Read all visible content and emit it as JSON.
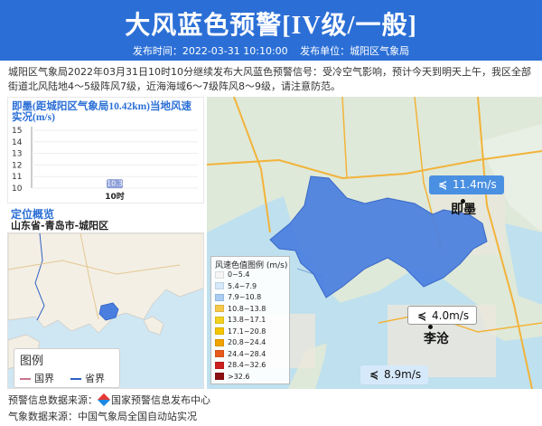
{
  "header": {
    "title": "大风蓝色预警[IV级/一般]",
    "publish_time_label": "发布时间：2022-03-31 10:10:00",
    "publish_unit_label": "发布单位：城阳区气象局"
  },
  "description": "城阳区气象局2022年03月31日10时10分继续发布大风蓝色预警信号：受冷空气影响，预计今天到明天上午，我区全部街道北风陆地4～5级阵风7级，近海海域6～7级阵风8～9级，请注意防范。",
  "chart": {
    "title": "即墨(距城阳区气象局10.42km)当地风速实况(m/s)"
  },
  "chart_data": {
    "type": "bar",
    "categories": [
      "10时"
    ],
    "values": [
      10.3
    ],
    "title": "即墨(距城阳区气象局10.42km)当地风速实况(m/s)",
    "ylabel": "m/s",
    "ylim": [
      10,
      15
    ],
    "yticks": [
      "15",
      "14",
      "13",
      "12",
      "11",
      "10"
    ],
    "data_labels": [
      "10.3"
    ],
    "colors": {
      "bar": "#aeb9dd",
      "label": "#8e9fd8",
      "grid": "#eeeeee"
    }
  },
  "location": {
    "title": "定位概览",
    "place": "山东省-青岛市-城阳区"
  },
  "minimap_legend": {
    "title": "图例",
    "national_border": "国界",
    "province_border": "省界",
    "national_border_color": "#c9748a",
    "province_border_color": "#2d5fc4"
  },
  "wind_scale": {
    "title": "风速色值图例 (m/s)",
    "items": [
      {
        "label": "0~5.4",
        "color": "#f5f5f5"
      },
      {
        "label": "5.4~7.9",
        "color": "#d6e9fb"
      },
      {
        "label": "7.9~10.8",
        "color": "#a7cdf3"
      },
      {
        "label": "10.8~13.8",
        "color": "#f7c94a"
      },
      {
        "label": "13.8~17.1",
        "color": "#f2d21f"
      },
      {
        "label": "17.1~20.8",
        "color": "#f5c400"
      },
      {
        "label": "20.8~24.4",
        "color": "#f0a300"
      },
      {
        "label": "24.4~28.4",
        "color": "#e85a1c"
      },
      {
        "label": "28.4~32.6",
        "color": "#cc1f1f"
      },
      {
        "label": ">32.6",
        "color": "#8c0f12"
      }
    ]
  },
  "stations": [
    {
      "speed": "11.4m/s",
      "name": "即墨",
      "style": "blue"
    },
    {
      "speed": "4.0m/s",
      "name": "李沧",
      "style": "white"
    },
    {
      "speed": "8.9m/s",
      "name": "",
      "style": "light"
    }
  ],
  "footer": {
    "source_warning": "预警信息数据来源：",
    "source_warning_org": "国家预警信息发布中心",
    "source_weather": "气象数据来源：中国气象局全国自动站实况"
  },
  "colors": {
    "header_bg": "#2b6fd6",
    "accent": "#2b6fd6",
    "region_fill": "#4a7fe0"
  }
}
